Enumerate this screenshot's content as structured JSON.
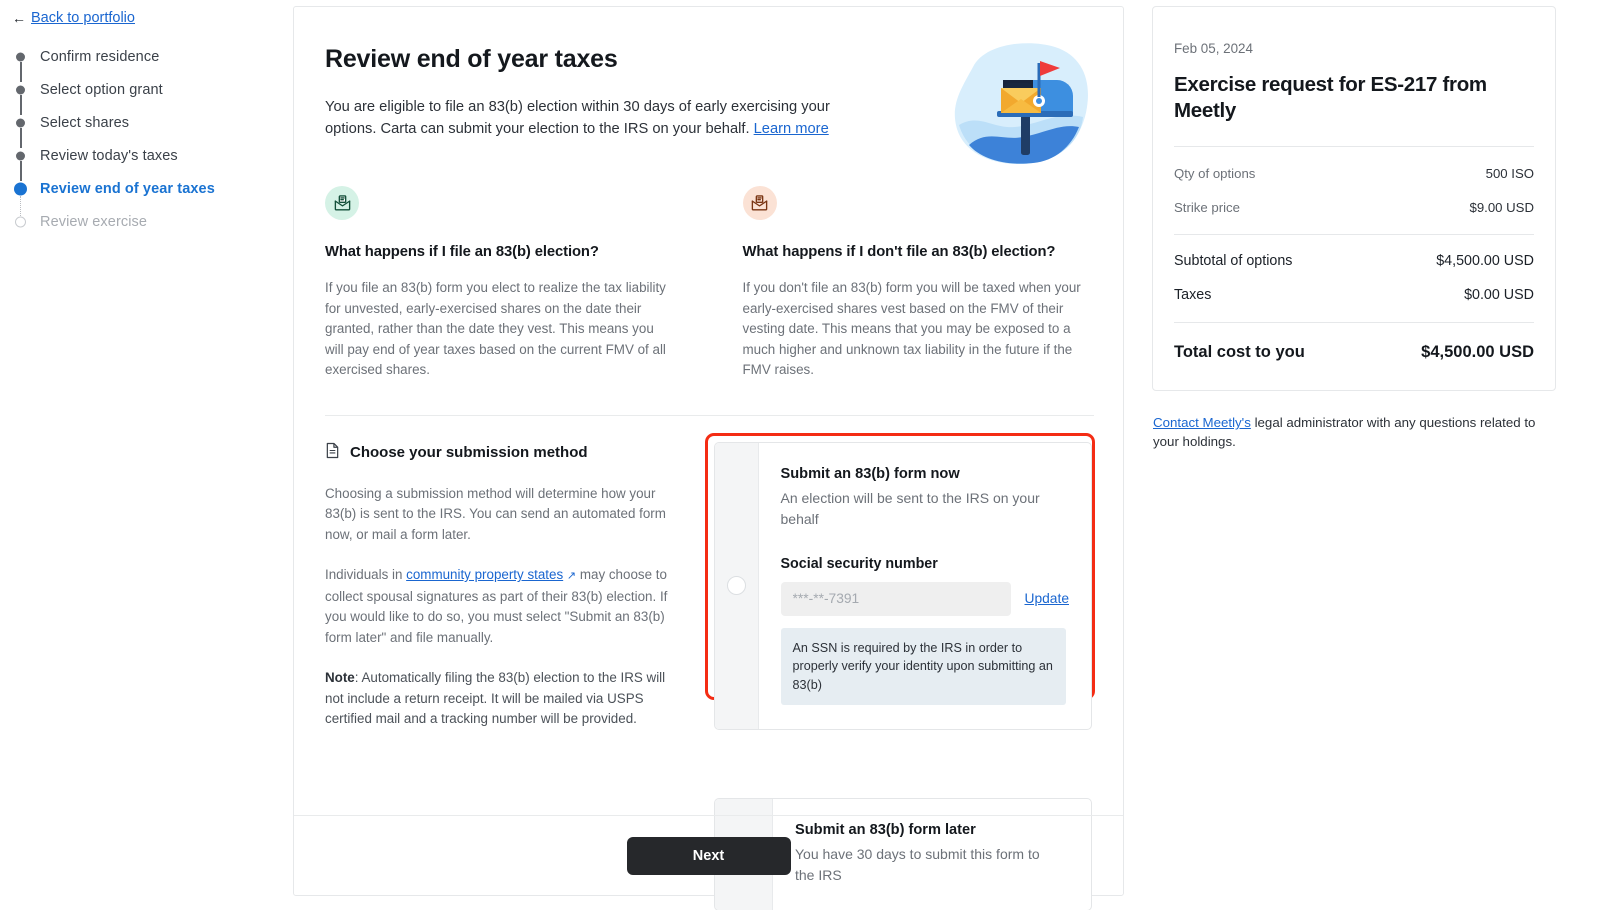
{
  "nav": {
    "back_label": "Back to portfolio",
    "back_arrow": "←",
    "steps": [
      {
        "label": "Confirm residence",
        "state": "done"
      },
      {
        "label": "Select option grant",
        "state": "done"
      },
      {
        "label": "Select shares",
        "state": "done"
      },
      {
        "label": "Review today's taxes",
        "state": "done"
      },
      {
        "label": "Review end of year taxes",
        "state": "active"
      },
      {
        "label": "Review exercise",
        "state": "pending"
      }
    ]
  },
  "main": {
    "title": "Review end of year taxes",
    "intro_text": "You are eligible to file an 83(b) election within 30 days of early exercising your options. Carta can submit your election to the IRS on your behalf. ",
    "intro_link": "Learn more",
    "faq": [
      {
        "icon": "mail-document-icon",
        "question": "What happens if I file an 83(b) election?",
        "answer": "If you file an 83(b) form you elect to realize the tax liability for unvested, early-exercised shares on the date their granted, rather than the date they vest. This means you will pay end of year taxes based on the current FMV of all exercised shares."
      },
      {
        "icon": "mail-document-icon",
        "question": "What happens if I don't file an 83(b) election?",
        "answer": "If you don't file an 83(b) form you will be taxed when your early-exercised shares vest based on the FMV of their vesting date. This means that you may be exposed to a much higher and unknown tax liability in the future if the FMV raises."
      }
    ],
    "submission": {
      "section_icon": "document-icon",
      "section_title": "Choose your submission method",
      "paragraph_1": "Choosing a submission method will determine how your 83(b) is sent to the IRS. You can send an automated form now, or mail a form later.",
      "paragraph_2_pre": "Individuals in ",
      "paragraph_2_link": "community property states",
      "paragraph_2_arrow": "↗",
      "paragraph_2_post": " may choose to collect spousal signatures as part of their 83(b) election. If you would like to do so, you must select \"Submit an 83(b) form later\" and file manually.",
      "note_label": "Note",
      "note_text": ": Automatically filing the 83(b) election to the IRS will not include a return receipt. It will be mailed via USPS certified mail and a tracking number will be provided."
    },
    "options": [
      {
        "title": "Submit an 83(b) form now",
        "subtitle": "An election will be sent to the IRS on your behalf",
        "selected": false,
        "highlighted": true,
        "field_label": "Social security number",
        "ssn_value": "***-**-7391",
        "ssn_placeholder": "***-**-7391",
        "update_label": "Update",
        "info_text": "An SSN is required by the IRS in order to properly verify your identity upon submitting an 83(b)"
      },
      {
        "title": "Submit an 83(b) form later",
        "subtitle": "You have 30 days to submit this form to the IRS",
        "selected": false,
        "highlighted": false
      }
    ],
    "next_label": "Next"
  },
  "summary": {
    "date": "Feb 05, 2024",
    "title": "Exercise request for ES-217 from Meetly",
    "rows_light": [
      {
        "label": "Qty of options",
        "value": "500 ISO"
      },
      {
        "label": "Strike price",
        "value": "$9.00 USD"
      }
    ],
    "rows_bold": [
      {
        "label": "Subtotal of options",
        "value": "$4,500.00 USD"
      },
      {
        "label": "Taxes",
        "value": "$0.00 USD"
      }
    ],
    "total": {
      "label": "Total cost to you",
      "value": "$4,500.00 USD"
    },
    "contact_link": "Contact Meetly's",
    "contact_text": " legal administrator with any questions related to your holdings."
  },
  "colors": {
    "accent_blue": "#1a73d2",
    "link_blue": "#1a66d0",
    "highlight_red": "#f42c14",
    "button_dark": "#26282b"
  }
}
